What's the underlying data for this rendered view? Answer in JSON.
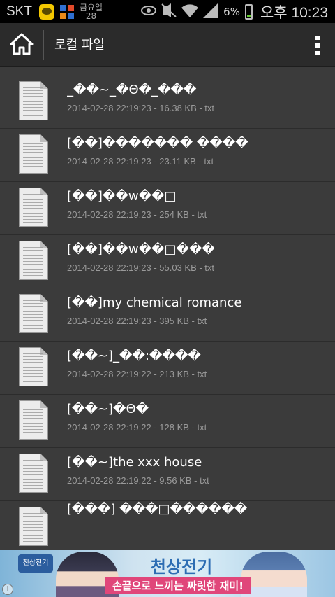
{
  "status_bar": {
    "carrier": "SKT",
    "date_line1": "금요일",
    "date_line2": "28",
    "battery_percent": "6%",
    "time": "오후 10:23",
    "icons": [
      "kakaotalk-icon",
      "app-block-icon",
      "eye-icon",
      "mute-icon",
      "wifi-icon",
      "signal-icon",
      "battery-icon"
    ]
  },
  "action_bar": {
    "title": "로컬 파일",
    "home_icon": "home-icon",
    "overflow_icon": "overflow-menu-icon"
  },
  "files": [
    {
      "name": "_��~_�Θ�_���",
      "meta": "2014-02-28 22:19:23 - 16.38 KB - txt"
    },
    {
      "name": "[��]������� ����",
      "meta": "2014-02-28 22:19:23 - 23.11 KB - txt"
    },
    {
      "name": "[��]��w��□",
      "meta": "2014-02-28 22:19:23 - 254 KB - txt"
    },
    {
      "name": "[��]��w��□���",
      "meta": "2014-02-28 22:19:23 - 55.03 KB - txt"
    },
    {
      "name": "[��]my chemical romance",
      "meta": "2014-02-28 22:19:23 - 395 KB - txt"
    },
    {
      "name": "[��~]_��:����",
      "meta": "2014-02-28 22:19:22 - 213 KB - txt"
    },
    {
      "name": "[��~]�Θ�",
      "meta": "2014-02-28 22:19:22 - 128 KB - txt"
    },
    {
      "name": "[��~]the xxx house",
      "meta": "2014-02-28 22:19:22 - 9.56 KB - txt"
    },
    {
      "name": "[���] ���□������",
      "meta": ""
    }
  ],
  "ad": {
    "logo": "천상전기",
    "title": "천상전기",
    "subtitle": "손끝으로 느끼는 짜릿한 재미!",
    "info_icon": "info-icon"
  },
  "colors": {
    "background": "#3b3b3b",
    "action_bar": "#2b2b2b",
    "status_bar": "#000000",
    "meta_text": "#9a9a9a"
  }
}
